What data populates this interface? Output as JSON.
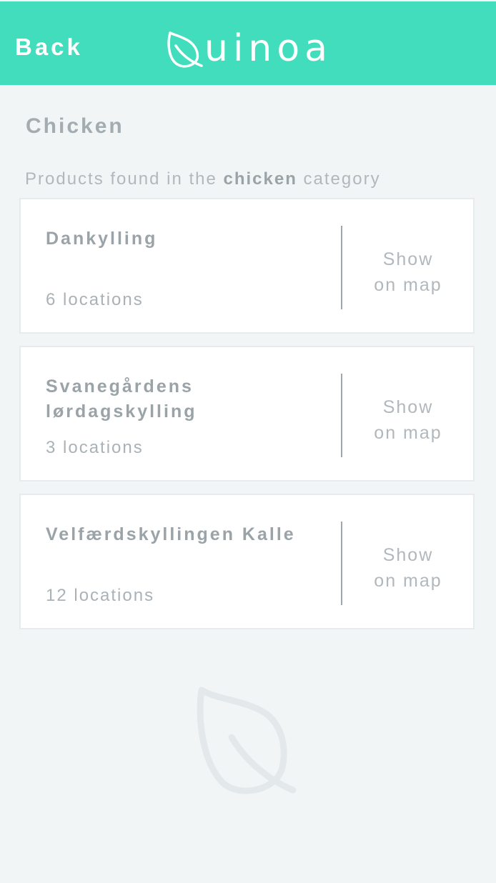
{
  "header": {
    "back_label": "Back",
    "logo_text": "uinoa",
    "logo_icon": "leaf-q-icon",
    "background": "#41ddbd"
  },
  "page": {
    "title": "Chicken",
    "subtitle_prefix": "Products found in the ",
    "subtitle_category": "chicken",
    "subtitle_suffix": " category"
  },
  "products": [
    {
      "name": "Dankylling",
      "locations": "6 locations",
      "action_line1": "Show",
      "action_line2": "on map"
    },
    {
      "name": "Svanegårdens lørdagskylling",
      "locations": "3 locations",
      "action_line1": "Show",
      "action_line2": "on map"
    },
    {
      "name": "Velfærdskyllingen Kalle",
      "locations": "12 locations",
      "action_line1": "Show",
      "action_line2": "on map"
    }
  ],
  "decoration": {
    "icon": "leaf-icon"
  }
}
